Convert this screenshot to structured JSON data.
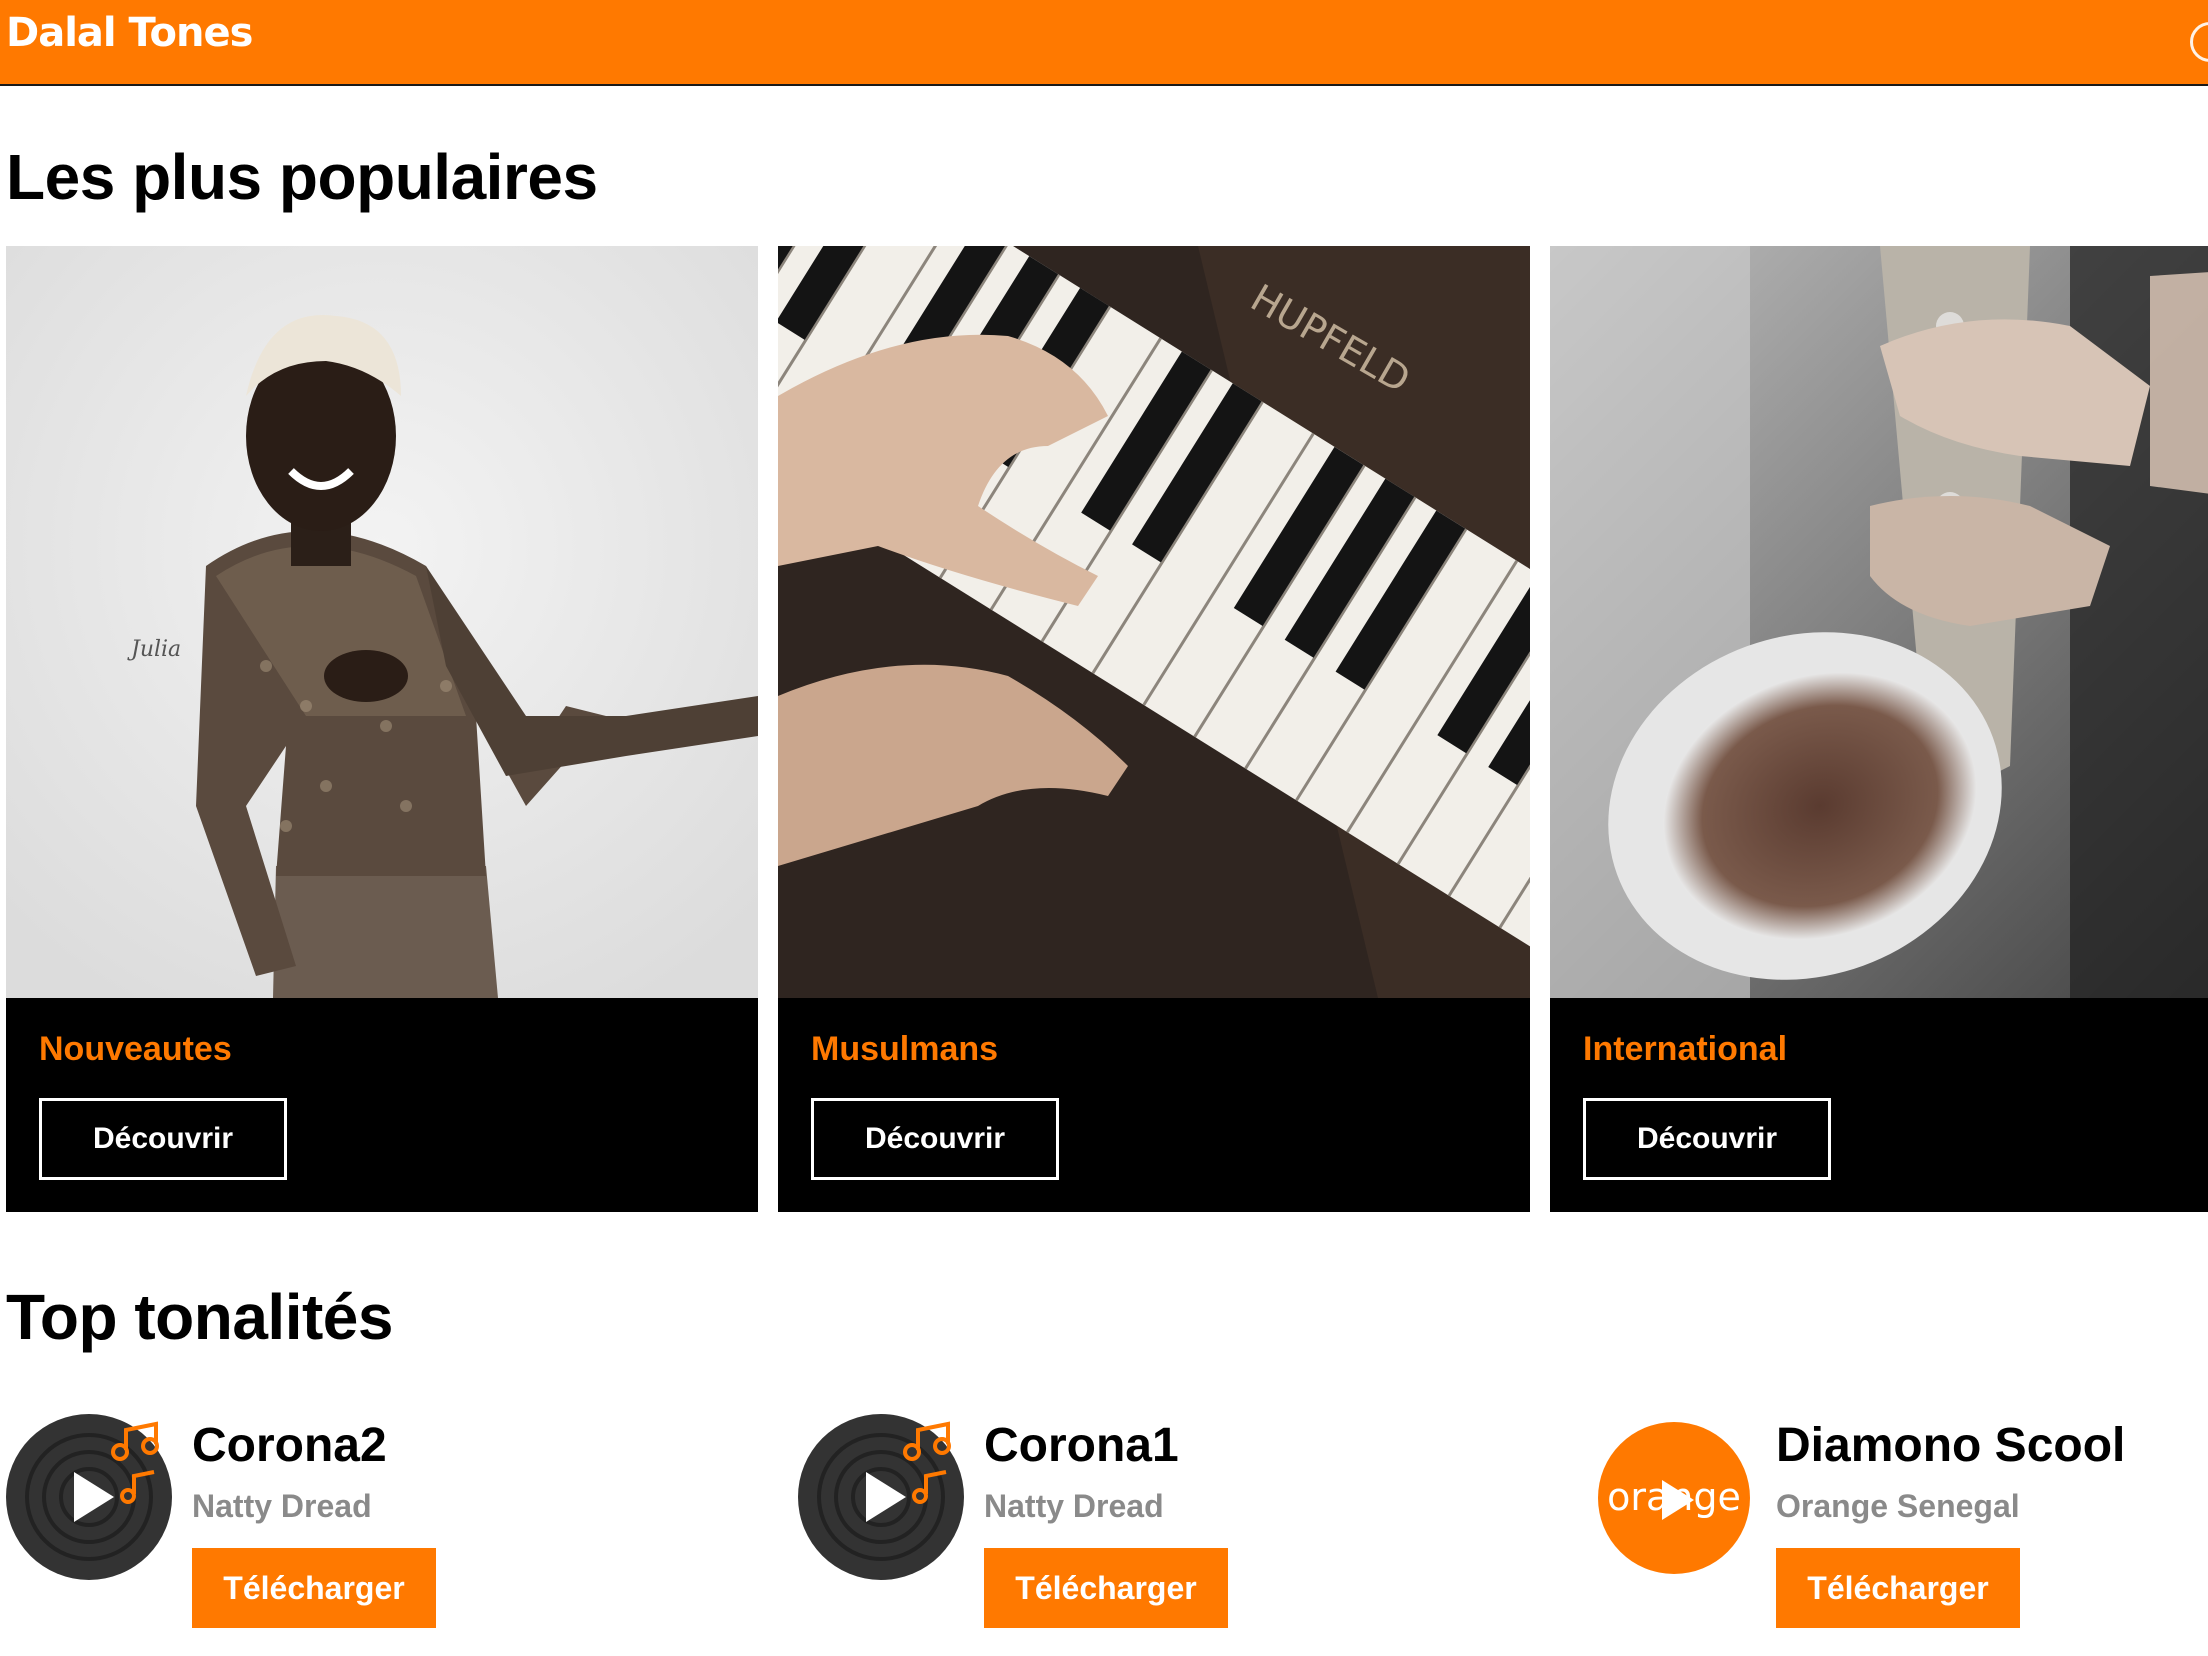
{
  "header": {
    "brand": "Dalal Tones"
  },
  "sections": {
    "popular_title": "Les plus populaires",
    "top_title": "Top tonalités"
  },
  "categories": [
    {
      "title": "Nouveautes",
      "button": "Découvrir",
      "image": "artist-portrait"
    },
    {
      "title": "Musulmans",
      "button": "Découvrir",
      "image": "piano-keys"
    },
    {
      "title": "International",
      "button": "Découvrir",
      "image": "saxophone"
    }
  ],
  "tones": [
    {
      "name": "Corona2",
      "artist": "Natty Dread",
      "button": "Télécharger",
      "icon": "music-disc-icon"
    },
    {
      "name": "Corona1",
      "artist": "Natty Dread",
      "button": "Télécharger",
      "icon": "music-disc-icon"
    },
    {
      "name": "Diamono Scool",
      "artist": "Orange Senegal",
      "button": "Télécharger",
      "icon": "orange-logo-icon",
      "logo_text": "orange"
    }
  ],
  "colors": {
    "accent": "#ff7900",
    "dark": "#000000",
    "muted": "#8a8a8a"
  }
}
